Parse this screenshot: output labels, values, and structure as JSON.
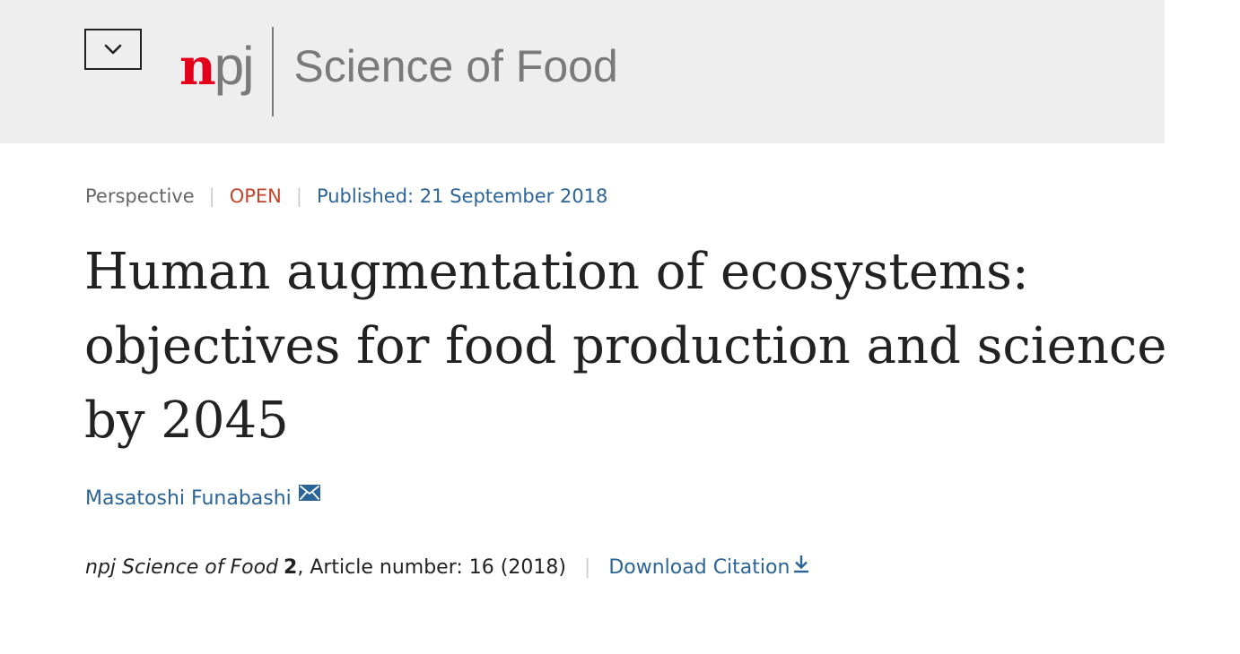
{
  "header": {
    "logo": {
      "npj_n": "n",
      "npj_pj": "pj",
      "journal_name": "Science of Food"
    },
    "menu_toggle_icon": "chevron-down-icon",
    "colors": {
      "background": "#eeeeee",
      "logo_red": "#e3001b",
      "logo_gray": "#7a7a7a"
    }
  },
  "article": {
    "type": "Perspective",
    "separator": "|",
    "access": "OPEN",
    "published": "Published: 21 September 2018",
    "title": "Human augmentation of ecosystems: objectives for food production and science by 2045",
    "authors": [
      {
        "name": "Masatoshi Funabashi",
        "icon": "mail-icon"
      }
    ],
    "citation": {
      "journal": "npj Science of Food",
      "volume": "2",
      "article_info": ", Article number: 16 (2018)",
      "download_label": "Download Citation",
      "download_icon": "download-icon"
    },
    "colors": {
      "link": "#2b6496",
      "open": "#c0472b",
      "text": "#222222",
      "muted": "#666666"
    }
  }
}
